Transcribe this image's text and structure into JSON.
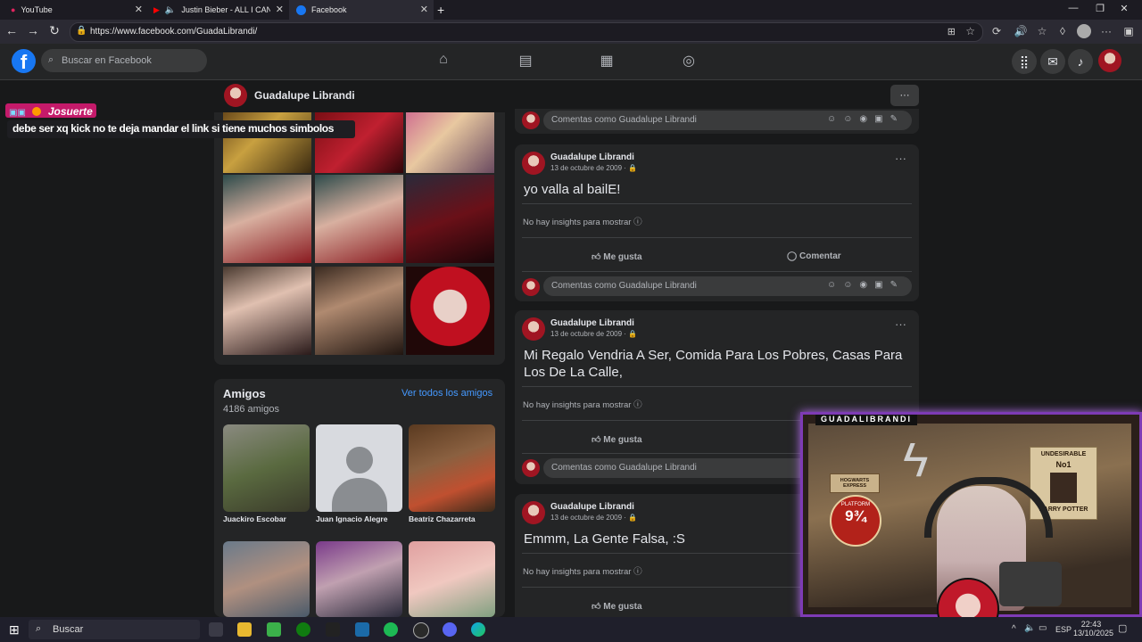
{
  "browser": {
    "tabs": [
      {
        "label": "YouTube",
        "icon": "youtube-icon"
      },
      {
        "label": "Justin Bieber - ALL I CAN TA",
        "icon": "youtube-icon"
      },
      {
        "label": "Facebook",
        "icon": "facebook-icon"
      }
    ],
    "new_tab": "+",
    "url": "https://www.facebook.com/GuadaLibrandi/"
  },
  "fb": {
    "logo": "f",
    "search_placeholder": "Buscar en Facebook"
  },
  "profile": {
    "name": "Guadalupe Librandi",
    "more": "···"
  },
  "friends": {
    "title": "Amigos",
    "count": "4186 amigos",
    "see_all": "Ver todos los amigos",
    "list": [
      {
        "name": "Juackiro Escobar"
      },
      {
        "name": "Juan Ignacio Alegre"
      },
      {
        "name": "Beatriz Chazarreta"
      }
    ]
  },
  "posts": {
    "comment_placeholder": "Comentas como Guadalupe Librandi",
    "like": "Me gusta",
    "comment": "Comentar",
    "insights": "No hay insights para mostrar",
    "items": [
      {
        "author": "Guadalupe Librandi",
        "date": "13 de octubre de 2009 ·",
        "text": "yo valla al bailE!"
      },
      {
        "author": "Guadalupe Librandi",
        "date": "13 de octubre de 2009 ·",
        "text": "Mi Regalo Vendria A Ser, Comida Para Los Pobres, Casas Para Los De La Calle,"
      },
      {
        "author": "Guadalupe Librandi",
        "date": "13 de octubre de 2009 ·",
        "text": "Emmm, La Gente Falsa, :S"
      }
    ]
  },
  "stream": {
    "chat_user": "Josuerte",
    "chat_message": "debe ser xq kick no te deja mandar el link si tiene muchos simbolos",
    "cam_title": "GUADALIBRANDI",
    "poster_top": "UNDESIRABLE",
    "poster_no": "No1",
    "poster_name": "HARRY POTTER",
    "sign1": "HOGWARTS EXPRESS",
    "sign2": "PLATFORM",
    "sign3": "9¾"
  },
  "taskbar": {
    "search": "Buscar",
    "lang": "ESP",
    "time": "22:43",
    "date": "13/10/2025"
  }
}
